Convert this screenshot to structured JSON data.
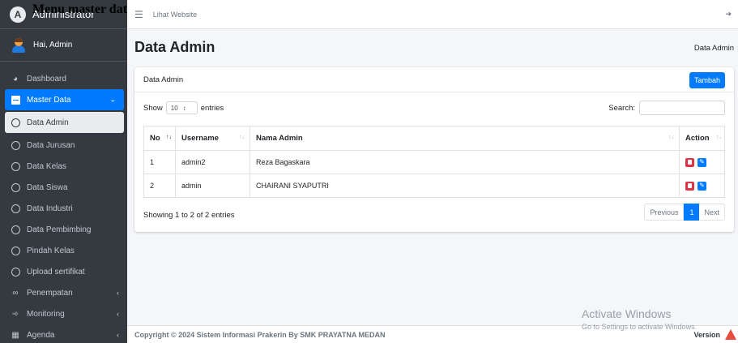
{
  "overlay_heading": "Menu master data",
  "brand": {
    "title": "Administrator"
  },
  "user": {
    "greeting": "Hai, Admin"
  },
  "sidebar": {
    "items": [
      {
        "label": "Dashboard",
        "icon": "dashboard-icon"
      },
      {
        "label": "Master Data",
        "icon": "book-icon",
        "active": true
      },
      {
        "label": "Data Admin",
        "icon": "circle-icon",
        "current": true
      },
      {
        "label": "Data Jurusan",
        "icon": "circle-icon"
      },
      {
        "label": "Data Kelas",
        "icon": "circle-icon"
      },
      {
        "label": "Data Siswa",
        "icon": "circle-icon"
      },
      {
        "label": "Data Industri",
        "icon": "circle-icon"
      },
      {
        "label": "Data Pembimbing",
        "icon": "circle-icon"
      },
      {
        "label": "Pindah Kelas",
        "icon": "circle-icon"
      },
      {
        "label": "Upload sertifikat",
        "icon": "circle-icon"
      },
      {
        "label": "Penempatan",
        "icon": "link-icon"
      },
      {
        "label": "Monitoring",
        "icon": "satellite-icon"
      },
      {
        "label": "Agenda",
        "icon": "calendar-icon"
      }
    ]
  },
  "topbar": {
    "link": "Lihat Website"
  },
  "page": {
    "title": "Data Admin",
    "breadcrumb": "Data Admin"
  },
  "card": {
    "title": "Data Admin",
    "add_button": "Tambah",
    "show_label": "Show",
    "entries_label": "entries",
    "page_length": "10",
    "search_label": "Search:",
    "search_value": ""
  },
  "table": {
    "headers": [
      "No",
      "Username",
      "Nama Admin",
      "Action"
    ],
    "rows": [
      {
        "no": "1",
        "username": "admin2",
        "nama": "Reza Bagaskara"
      },
      {
        "no": "2",
        "username": "admin",
        "nama": "CHAIRANI SYAPUTRI"
      }
    ]
  },
  "pagination": {
    "info": "Showing 1 to 2 of 2 entries",
    "previous": "Previous",
    "current": "1",
    "next": "Next"
  },
  "footer": {
    "copyright": "Copyright © 2024 Sistem Informasi Prakerin By SMK PRAYATNA MEDAN",
    "version": "Version"
  },
  "watermark": {
    "title": "Activate Windows",
    "subtitle": "Go to Settings to activate Windows."
  },
  "colors": {
    "sidebar_bg": "#343a40",
    "accent": "#007bff",
    "danger": "#dc3545"
  }
}
